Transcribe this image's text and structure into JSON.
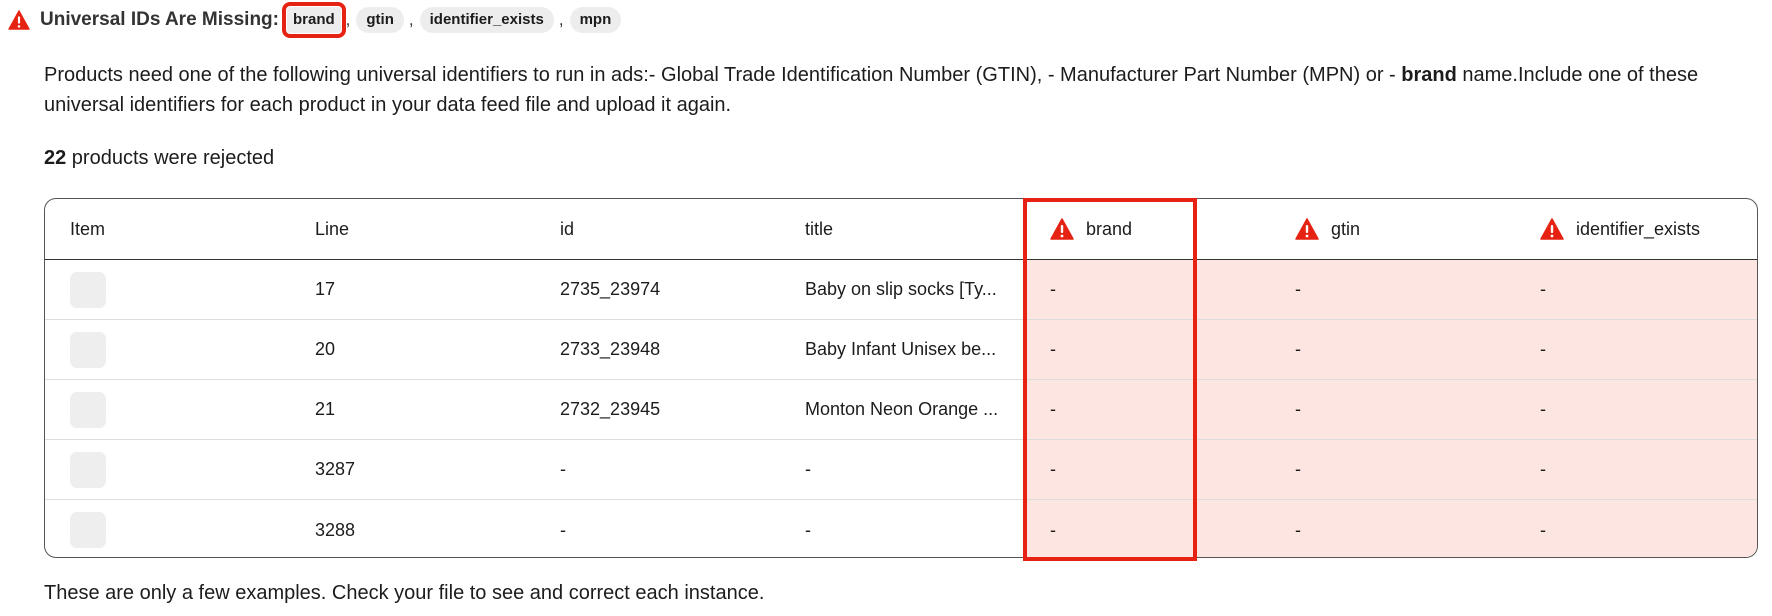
{
  "header": {
    "title": "Universal IDs Are Missing:",
    "tags": [
      "brand",
      "gtin",
      "identifier_exists",
      "mpn"
    ],
    "separator": ",",
    "icon": "warning-triangle-icon",
    "icon_color": "#e62312"
  },
  "description": {
    "before_bold": "Products need one of the following universal identifiers to run in ads:- Global Trade Identification Number (GTIN), - Manufacturer Part Number (MPN) or - ",
    "bold": "brand",
    "after_bold": " name.Include one of these universal identifiers for each product in your data feed file and upload it again."
  },
  "rejected": {
    "count": "22",
    "text": " products were rejected"
  },
  "table": {
    "columns": {
      "item": "Item",
      "line": "Line",
      "id": "id",
      "title": "title",
      "brand": "brand",
      "gtin": "gtin",
      "identifier_exists": "identifier_exists"
    },
    "error_column_icon": "warning-triangle-icon",
    "error_cell_color": "#fde6e1",
    "rows": [
      {
        "line": "17",
        "id": "2735_23974",
        "title": "Baby on slip socks [Ty...",
        "brand": "-",
        "gtin": "-",
        "identifier_exists": "-"
      },
      {
        "line": "20",
        "id": "2733_23948",
        "title": "Baby Infant Unisex be...",
        "brand": "-",
        "gtin": "-",
        "identifier_exists": "-"
      },
      {
        "line": "21",
        "id": "2732_23945",
        "title": "Monton Neon Orange ...",
        "brand": "-",
        "gtin": "-",
        "identifier_exists": "-"
      },
      {
        "line": "3287",
        "id": "-",
        "title": "-",
        "brand": "-",
        "gtin": "-",
        "identifier_exists": "-"
      },
      {
        "line": "3288",
        "id": "-",
        "title": "-",
        "brand": "-",
        "gtin": "-",
        "identifier_exists": "-"
      }
    ]
  },
  "footer": {
    "note": "These are only a few examples. Check your file to see and correct each instance."
  },
  "highlight_color": "#e62312"
}
